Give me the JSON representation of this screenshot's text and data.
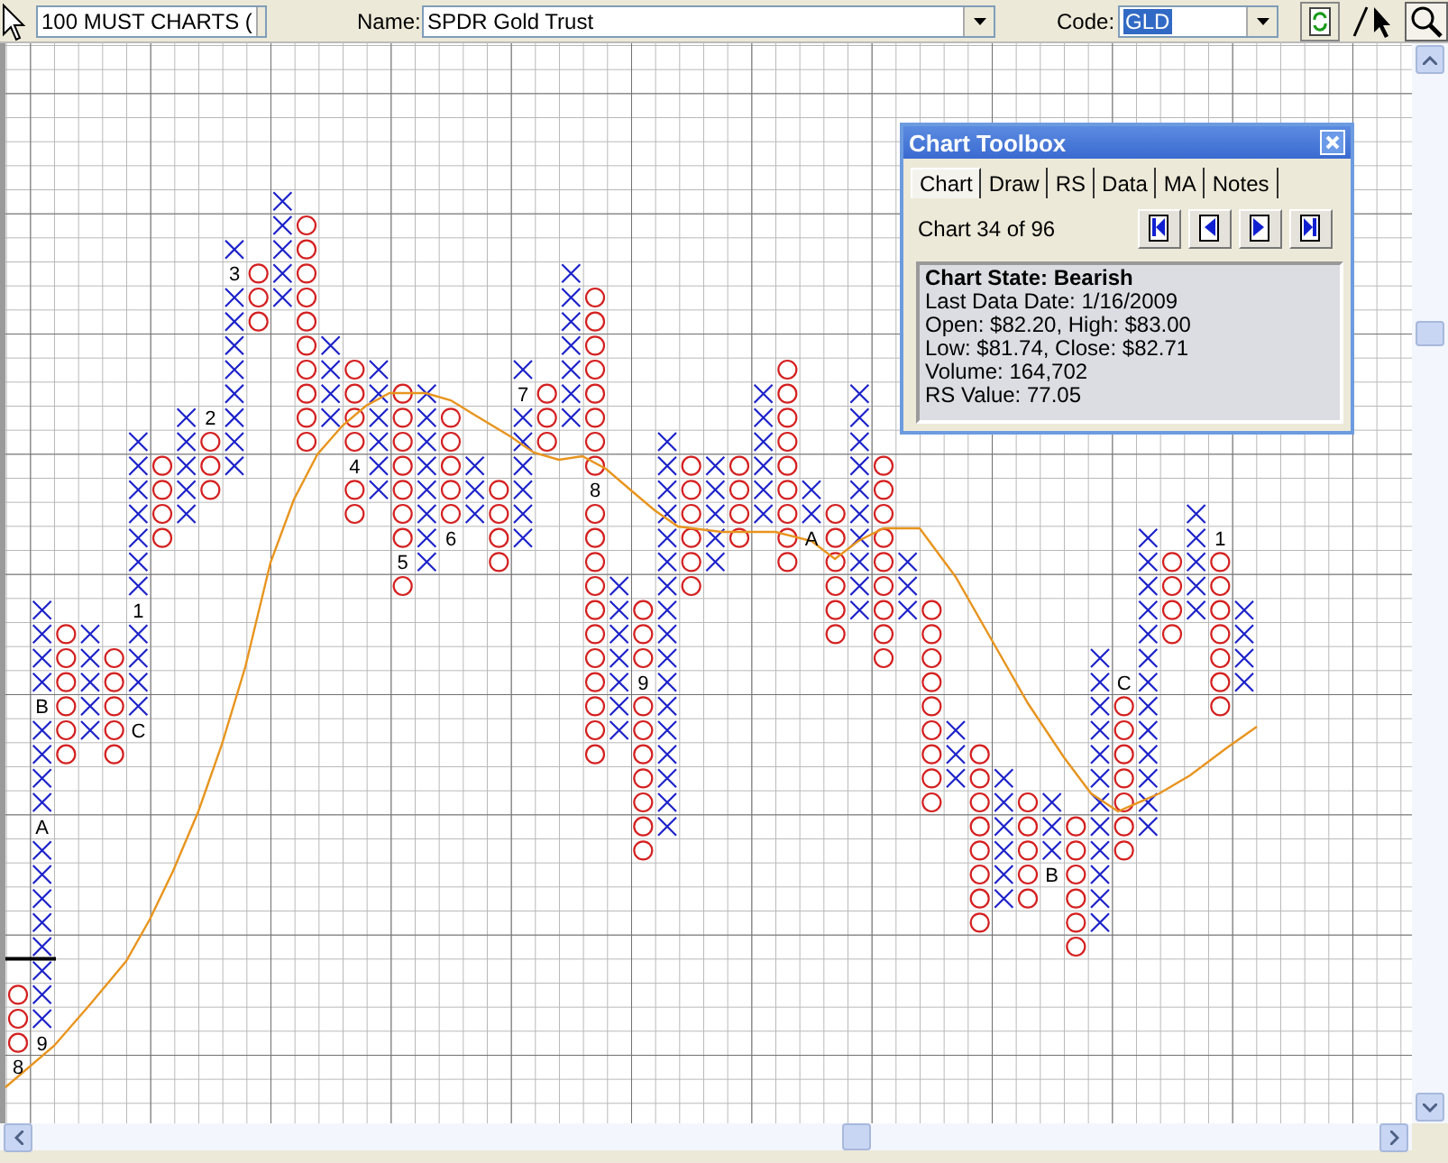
{
  "toolbar": {
    "list_combo": "100 MUST CHARTS (",
    "name_label": "Name:",
    "name_combo": "SPDR Gold Trust",
    "code_label": "Code:",
    "code_combo": "GLD"
  },
  "chart": {
    "markers": [
      "8",
      "B",
      "A",
      "9",
      "1",
      "C",
      "2",
      "3",
      "4",
      "5",
      "6",
      "7",
      "8",
      "9",
      "A",
      "B",
      "C",
      "1"
    ]
  },
  "toolbox": {
    "title": "Chart Toolbox",
    "tabs": [
      {
        "label": "Chart",
        "selected": true
      },
      {
        "label": "Draw",
        "selected": false
      },
      {
        "label": "RS",
        "selected": false
      },
      {
        "label": "Data",
        "selected": false
      },
      {
        "label": "MA",
        "selected": false
      },
      {
        "label": "Notes",
        "selected": false
      }
    ],
    "counter": "Chart 34 of 96",
    "state": "Chart State: Bearish",
    "lines": [
      "Last Data Date: 1/16/2009",
      "Open: $82.20, High: $83.00",
      "Low: $81.74, Close: $82.71",
      "Volume: 164,702",
      "RS Value: 77.05"
    ]
  }
}
